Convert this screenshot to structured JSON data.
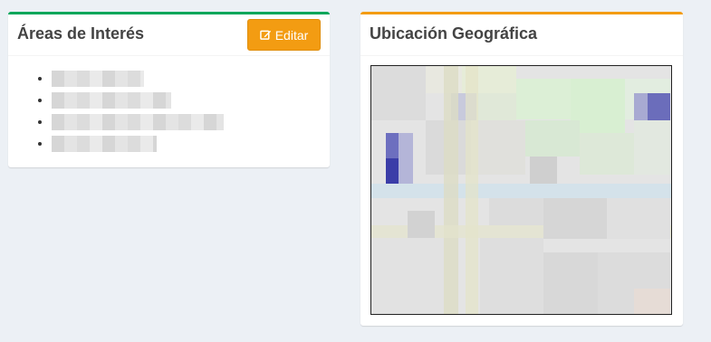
{
  "interests_panel": {
    "title": "Áreas de Interés",
    "edit_button_label": "Editar",
    "items": [
      "",
      "",
      "",
      ""
    ]
  },
  "location_panel": {
    "title": "Ubicación Geográfica"
  },
  "colors": {
    "interests_accent": "#00a65a",
    "location_accent": "#f39c12",
    "edit_button": "#f39c12"
  },
  "icons": {
    "edit": "pencil-square-icon"
  }
}
